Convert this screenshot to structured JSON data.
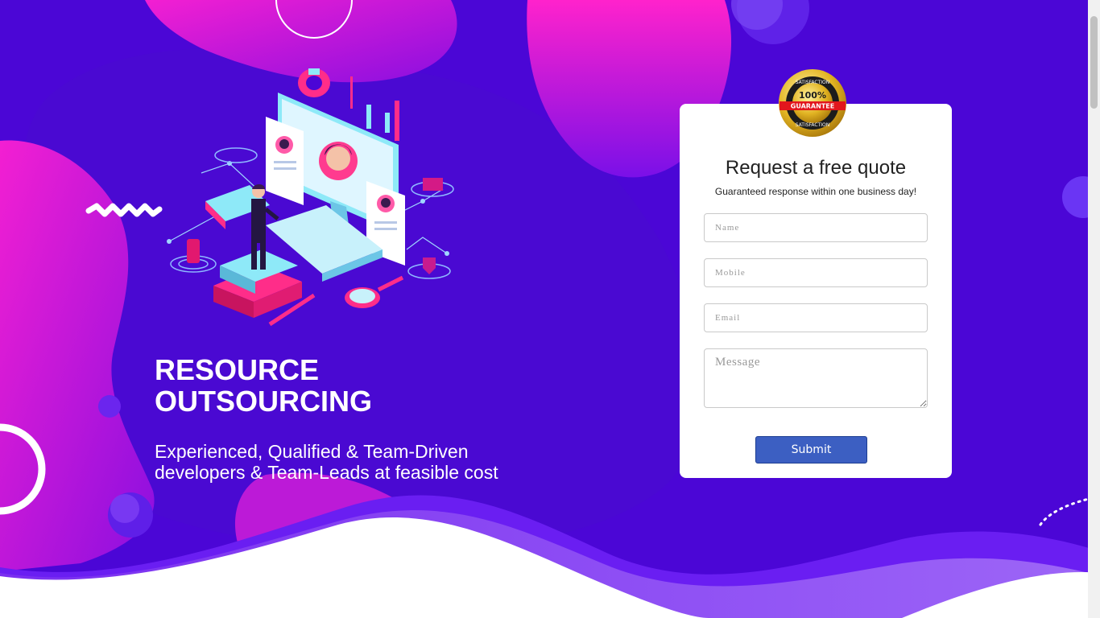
{
  "hero": {
    "title": "RESOURCE OUTSOURCING",
    "subtitle": "Experienced, Qualified & Team-Driven developers & Team-Leads at feasible cost"
  },
  "badge": {
    "top_text": "SATISFACTION",
    "center_text": "100%",
    "ribbon_text": "GUARANTEE",
    "bottom_text": "SATISFACTION"
  },
  "quote_form": {
    "title": "Request a free quote",
    "subtitle": "Guaranteed response within one business day!",
    "name_placeholder": "Name",
    "mobile_placeholder": "Mobile",
    "email_placeholder": "Email",
    "message_placeholder": "Message",
    "submit_label": "Submit"
  },
  "colors": {
    "background": "#4b06d6",
    "blob_magenta": "#ee1fd8",
    "submit_button": "#3c5fc2",
    "card": "#ffffff"
  },
  "icons": [
    "satisfaction-guarantee-badge-icon",
    "resume-profile-illustration",
    "decorative-zigzag",
    "decorative-ring"
  ]
}
